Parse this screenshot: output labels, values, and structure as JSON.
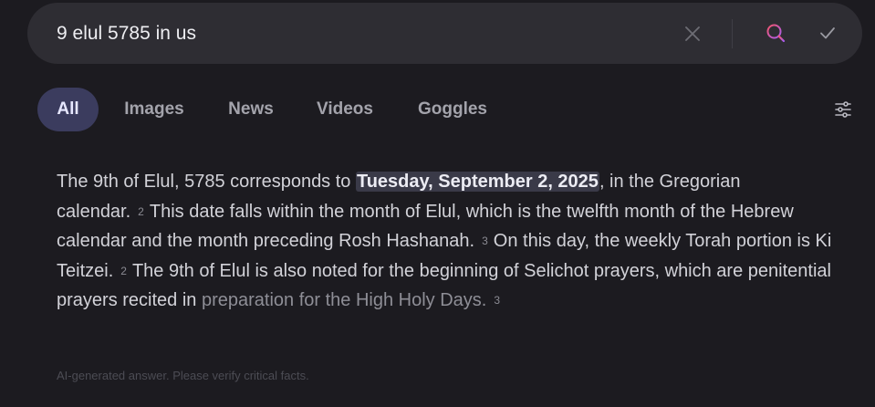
{
  "search": {
    "query": "9 elul 5785 in us"
  },
  "tabs": [
    {
      "label": "All",
      "active": true
    },
    {
      "label": "Images",
      "active": false
    },
    {
      "label": "News",
      "active": false
    },
    {
      "label": "Videos",
      "active": false
    },
    {
      "label": "Goggles",
      "active": false
    }
  ],
  "icons": {
    "clear": "close-icon",
    "search": "search-icon",
    "submit": "check-icon",
    "filters": "sliders-icon"
  },
  "colors": {
    "background": "#1c1b20",
    "search_bar": "#2e2d33",
    "active_tab": "#3b3c5e",
    "search_icon_start": "#f3546c",
    "search_icon_end": "#a75ef0",
    "highlight": "#3a3a48"
  },
  "answer": {
    "p1": "The 9th of Elul, 5785 corresponds to ",
    "highlight": "Tuesday, September 2, 2025",
    "p2": ", in the Gregorian calendar.",
    "cite1": "2",
    "p3": "This date falls within the month of Elul, which is the twelfth month of the Hebrew calendar and the month preceding Rosh Hashanah.",
    "cite2": "3",
    "p4": "On this day, the weekly Torah portion is Ki Teitzei.",
    "cite3": "2",
    "p5a": "The 9th of Elul is also noted for the beginning of Selichot prayers, which are penitential prayers recited in ",
    "p5b": "preparation for the High Holy Days.",
    "cite4": "3"
  },
  "disclaimer": "AI-generated answer. Please verify critical facts."
}
